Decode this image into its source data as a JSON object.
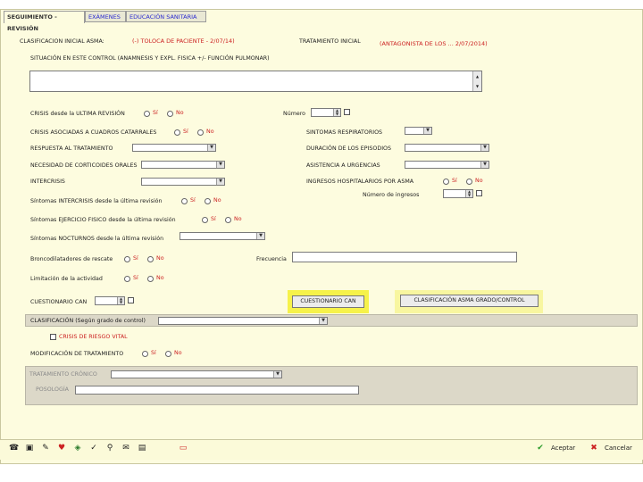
{
  "tabs": [
    {
      "label": "SEGUIMIENTO - REVISIÓN",
      "active": true
    },
    {
      "label": "EXÁMENES",
      "active": false
    },
    {
      "label": "EDUCACIÓN SANITARIA",
      "active": false
    }
  ],
  "clasificacion": {
    "label": "CLASIFICACION INICIAL ASMA:",
    "value": "(-) TOLOCA DE PACIENTE - 2/07/14)"
  },
  "tratamiento": {
    "label": "TRATAMIENTO INICIAL",
    "value": "(ANTAGONISTA DE LOS ... 2/07/2014)"
  },
  "situacion": {
    "label": "SITUACIÓN EN ESTE CONTROL (ANAMNESIS Y EXPL. FISICA +/- FUNCIÓN PULMONAR)"
  },
  "crisis": {
    "label": "CRISIS desde la ULTIMA REVISIÓN",
    "si": "Sí",
    "no": "No",
    "numero_label": "Número"
  },
  "crisis_catarrales": {
    "label": "CRISIS ASOCIADAS A CUADROS CATARRALES",
    "si": "Sí",
    "no": "No"
  },
  "sintomas_resp": {
    "label": "SINTOMAS RESPIRATORIOS"
  },
  "respuesta": {
    "label": "RESPUESTA AL TRATAMIENTO"
  },
  "duracion": {
    "label": "DURACIÓN DE LOS EPISODIOS"
  },
  "necesidad": {
    "label": "NECESIDAD DE CORTICOIDES ORALES"
  },
  "asistencia": {
    "label": "ASISTENCIA A URGENCIAS"
  },
  "intercrisis": {
    "label": "INTERCRISIS"
  },
  "ingresos": {
    "label": "INGRESOS HOSPITALARIOS POR ASMA",
    "si": "Sí",
    "no": "No",
    "numero_label": "Número de ingresos"
  },
  "nocturnos_int": {
    "label": "Síntomas INTERCRISIS desde la última revisión",
    "si": "Sí",
    "no": "No"
  },
  "ejercicio": {
    "label": "Síntomas EJERCICIO FISICO desde la última revisión",
    "si": "Sí",
    "no": "No"
  },
  "nocturnos": {
    "label": "Síntomas NOCTURNOS desde la última revisión"
  },
  "broncodilat": {
    "label": "Broncodilatadores de rescate",
    "si": "Sí",
    "no": "No",
    "frecuencia_label": "Frecuencia"
  },
  "limitacion": {
    "label": "Limitación de la actividad",
    "si": "Sí",
    "no": "No"
  },
  "cuestionario": {
    "label": "CUESTIONARIO CAN",
    "button": "CUESTIONARIO CAN",
    "clasif_button": "CLASIFICACIÓN ASMA GRADO/CONTROL"
  },
  "clasif_control": {
    "label": "CLASIFICACIÓN (Según grado de control)"
  },
  "riesgo": {
    "label": "CRISIS DE RIESGO VITAL"
  },
  "modificacion": {
    "label": "MODIFICACIÓN DE TRATAMIENTO",
    "si": "Sí",
    "no": "No"
  },
  "tratamiento_crono": {
    "label": "TRATAMIENTO CRÓNICO"
  },
  "posologia": {
    "label": "POSOLOGÍA"
  },
  "footer": {
    "aceptar": "Aceptar",
    "cancelar": "Cancelar"
  },
  "colors": {
    "window_bg": "#fdfcdf",
    "value_red": "#cc2222",
    "highlight": "#f6f24a",
    "section_grey": "#dcd8c8"
  }
}
